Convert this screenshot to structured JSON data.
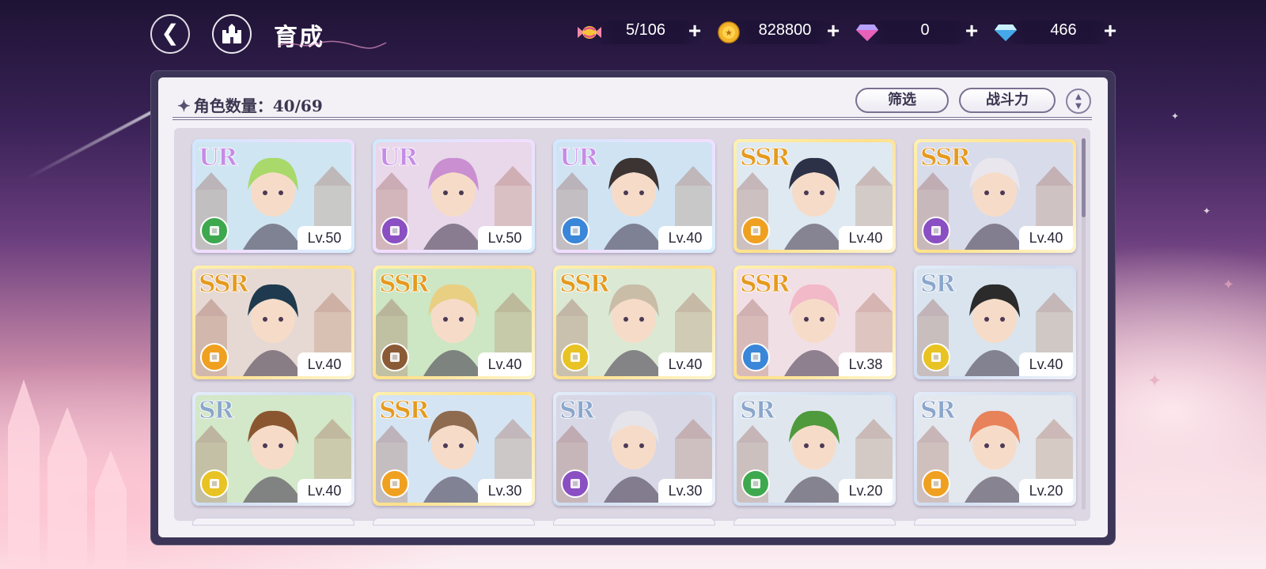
{
  "header": {
    "title": "育成",
    "resources": [
      {
        "name": "candy",
        "value": "5/106"
      },
      {
        "name": "gold-coin",
        "value": "828800"
      },
      {
        "name": "pink-gem",
        "value": "0"
      },
      {
        "name": "blue-diamond",
        "value": "466"
      }
    ]
  },
  "panel": {
    "count_label": "角色数量：40/69",
    "filter_label": "筛选",
    "sort_label": "战斗力"
  },
  "colors": {
    "class_green": "#3ea84f",
    "class_purple": "#8a4fc2",
    "class_blue": "#3a86d8",
    "class_orange": "#f0a020",
    "class_brown": "#8a5a36",
    "class_gold": "#e8c323"
  },
  "characters": [
    {
      "rarity": "UR",
      "level": "Lv.50",
      "class_color": "#3ea84f",
      "hair": "#a8d96a",
      "bg": "#cfe5f2"
    },
    {
      "rarity": "UR",
      "level": "Lv.50",
      "class_color": "#8a4fc2",
      "hair": "#c98fd1",
      "bg": "#e9d7ea"
    },
    {
      "rarity": "UR",
      "level": "Lv.40",
      "class_color": "#3a86d8",
      "hair": "#3b3432",
      "bg": "#cfe3f3"
    },
    {
      "rarity": "SSR",
      "level": "Lv.40",
      "class_color": "#f0a020",
      "hair": "#2d3147",
      "bg": "#dfe9f1"
    },
    {
      "rarity": "SSR",
      "level": "Lv.40",
      "class_color": "#8a4fc2",
      "hair": "#e9e6ee",
      "bg": "#d8dbea"
    },
    {
      "rarity": "SSR",
      "level": "Lv.40",
      "class_color": "#f0a020",
      "hair": "#1f3a4f",
      "bg": "#e6d9d3"
    },
    {
      "rarity": "SSR",
      "level": "Lv.40",
      "class_color": "#8a5a36",
      "hair": "#e8cf82",
      "bg": "#cde6c4"
    },
    {
      "rarity": "SSR",
      "level": "Lv.40",
      "class_color": "#e8c323",
      "hair": "#c9bda8",
      "bg": "#dbe9d4"
    },
    {
      "rarity": "SSR",
      "level": "Lv.38",
      "class_color": "#3a86d8",
      "hair": "#f2b9c8",
      "bg": "#f1dfe6"
    },
    {
      "rarity": "SR",
      "level": "Lv.40",
      "class_color": "#e8c323",
      "hair": "#2b2b2b",
      "bg": "#d9e4ee"
    },
    {
      "rarity": "SR",
      "level": "Lv.40",
      "class_color": "#e8c323",
      "hair": "#8a5630",
      "bg": "#d3e7c9"
    },
    {
      "rarity": "SSR",
      "level": "Lv.30",
      "class_color": "#f0a020",
      "hair": "#8e6a4e",
      "bg": "#d4e4f3"
    },
    {
      "rarity": "SR",
      "level": "Lv.30",
      "class_color": "#8a4fc2",
      "hair": "#e4e4ea",
      "bg": "#d7d7e6"
    },
    {
      "rarity": "SR",
      "level": "Lv.20",
      "class_color": "#3ea84f",
      "hair": "#4f9a3c",
      "bg": "#dfe6ee"
    },
    {
      "rarity": "SR",
      "level": "Lv.20",
      "class_color": "#f0a020",
      "hair": "#e8825a",
      "bg": "#e3e7ee"
    }
  ]
}
